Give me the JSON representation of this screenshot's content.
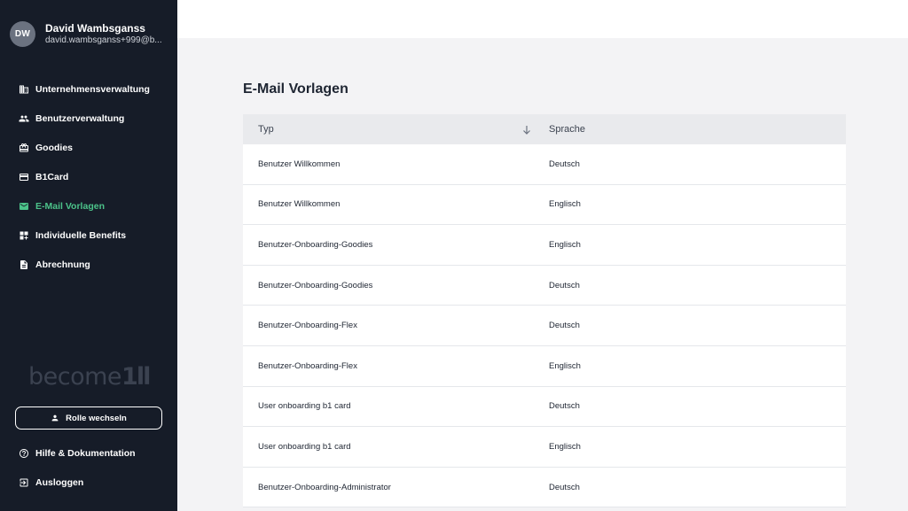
{
  "user": {
    "initials": "DW",
    "name": "David Wambsganss",
    "email": "david.wambsganss+999@b..."
  },
  "nav": [
    {
      "label": "Unternehmensverwaltung",
      "icon": "building-icon",
      "active": false
    },
    {
      "label": "Benutzerverwaltung",
      "icon": "users-icon",
      "active": false
    },
    {
      "label": "Goodies",
      "icon": "gift-icon",
      "active": false
    },
    {
      "label": "B1Card",
      "icon": "card-icon",
      "active": false
    },
    {
      "label": "E-Mail Vorlagen",
      "icon": "mail-icon",
      "active": true
    },
    {
      "label": "Individuelle Benefits",
      "icon": "dashboard-add-icon",
      "active": false
    },
    {
      "label": "Abrechnung",
      "icon": "document-icon",
      "active": false
    }
  ],
  "logo": {
    "text": "become",
    "mark": "1ll"
  },
  "role_button": {
    "label": "Rolle wechseln"
  },
  "bottom_nav": [
    {
      "label": "Hilfe & Dokumentation",
      "icon": "help-icon"
    },
    {
      "label": "Ausloggen",
      "icon": "logout-icon"
    }
  ],
  "page": {
    "title": "E-Mail Vorlagen"
  },
  "table": {
    "columns": {
      "type": "Typ",
      "language": "Sprache"
    },
    "rows": [
      {
        "type": "Benutzer Willkommen",
        "language": "Deutsch"
      },
      {
        "type": "Benutzer Willkommen",
        "language": "Englisch"
      },
      {
        "type": "Benutzer-Onboarding-Goodies",
        "language": "Englisch"
      },
      {
        "type": "Benutzer-Onboarding-Goodies",
        "language": "Deutsch"
      },
      {
        "type": "Benutzer-Onboarding-Flex",
        "language": "Deutsch"
      },
      {
        "type": "Benutzer-Onboarding-Flex",
        "language": "Englisch"
      },
      {
        "type": "User onboarding b1 card",
        "language": "Deutsch"
      },
      {
        "type": "User onboarding b1 card",
        "language": "Englisch"
      },
      {
        "type": "Benutzer-Onboarding-Administrator",
        "language": "Deutsch"
      }
    ]
  },
  "colors": {
    "sidebar_bg": "#161c28",
    "accent": "#4cc38a",
    "page_bg": "#f3f3f5",
    "header_bg": "#e9eaed"
  }
}
